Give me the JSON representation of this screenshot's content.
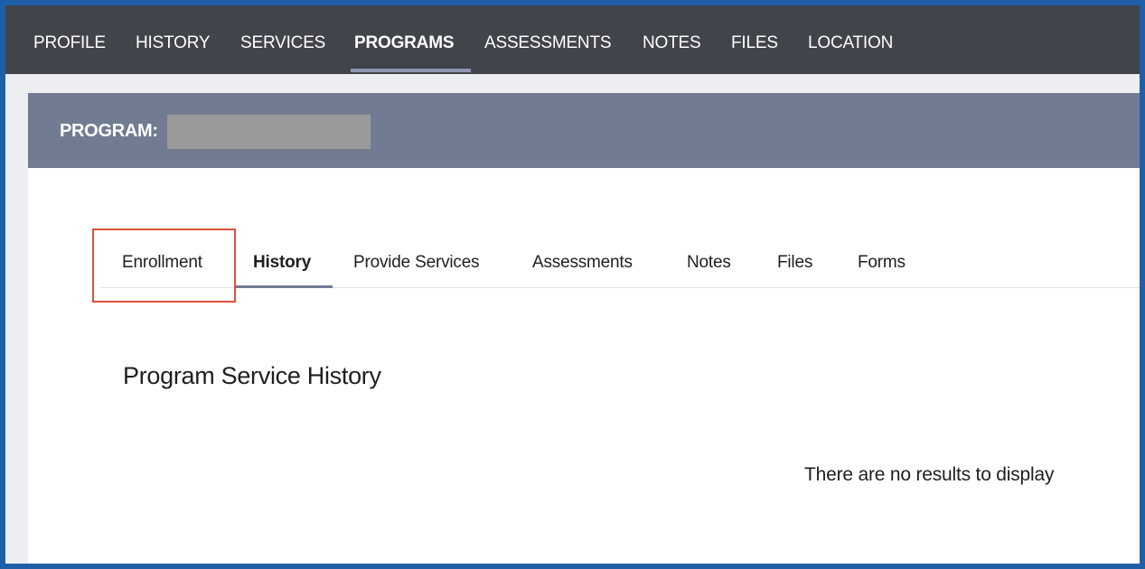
{
  "topnav": {
    "items": [
      {
        "label": "PROFILE"
      },
      {
        "label": "HISTORY"
      },
      {
        "label": "SERVICES"
      },
      {
        "label": "PROGRAMS",
        "active": true
      },
      {
        "label": "ASSESSMENTS"
      },
      {
        "label": "NOTES"
      },
      {
        "label": "FILES"
      },
      {
        "label": "LOCATION"
      }
    ]
  },
  "program": {
    "label": "PROGRAM:",
    "name_redacted": true
  },
  "subtabs": {
    "items": [
      {
        "label": "Enrollment",
        "highlighted": true
      },
      {
        "label": "History",
        "active": true
      },
      {
        "label": "Provide Services"
      },
      {
        "label": "Assessments"
      },
      {
        "label": "Notes"
      },
      {
        "label": "Files"
      },
      {
        "label": "Forms"
      }
    ]
  },
  "section": {
    "title": "Program Service History",
    "empty_message": "There are no results to display"
  },
  "colors": {
    "topnav_bg": "#41444b",
    "program_header_bg": "#717c93",
    "highlight_border": "#e0513a",
    "frame_border": "#1f5fa8"
  }
}
